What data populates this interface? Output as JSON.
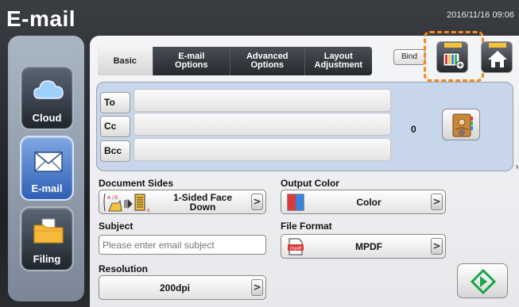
{
  "header": {
    "title": "E-mail",
    "datetime": "2016/11/16 09:06"
  },
  "sidebar": {
    "items": [
      {
        "label": "Cloud",
        "icon": "cloud-icon"
      },
      {
        "label": "E-mail",
        "icon": "envelope-icon",
        "active": true
      },
      {
        "label": "Filing",
        "icon": "folder-icon"
      }
    ]
  },
  "tabs": [
    {
      "label": "Basic",
      "active": true
    },
    {
      "label": "E-mail Options"
    },
    {
      "label": "Advanced Options"
    },
    {
      "label": "Layout Adjustment"
    }
  ],
  "toolbar": {
    "bind_label": "Bind",
    "highlight_color": "#f08a24"
  },
  "recipients": {
    "to_label": "To",
    "cc_label": "Cc",
    "bcc_label": "Bcc",
    "count": "0"
  },
  "document_sides": {
    "label": "Document Sides",
    "value": "1-Sided Face Down"
  },
  "output_color": {
    "label": "Output Color",
    "value": "Color"
  },
  "subject": {
    "label": "Subject",
    "placeholder": "Please enter email subject"
  },
  "file_format": {
    "label": "File Format",
    "value": "MPDF"
  },
  "resolution": {
    "label": "Resolution",
    "value": "200dpi"
  },
  "colors": {
    "accent": "#2f5fb4",
    "start_green": "#1aa64a"
  }
}
